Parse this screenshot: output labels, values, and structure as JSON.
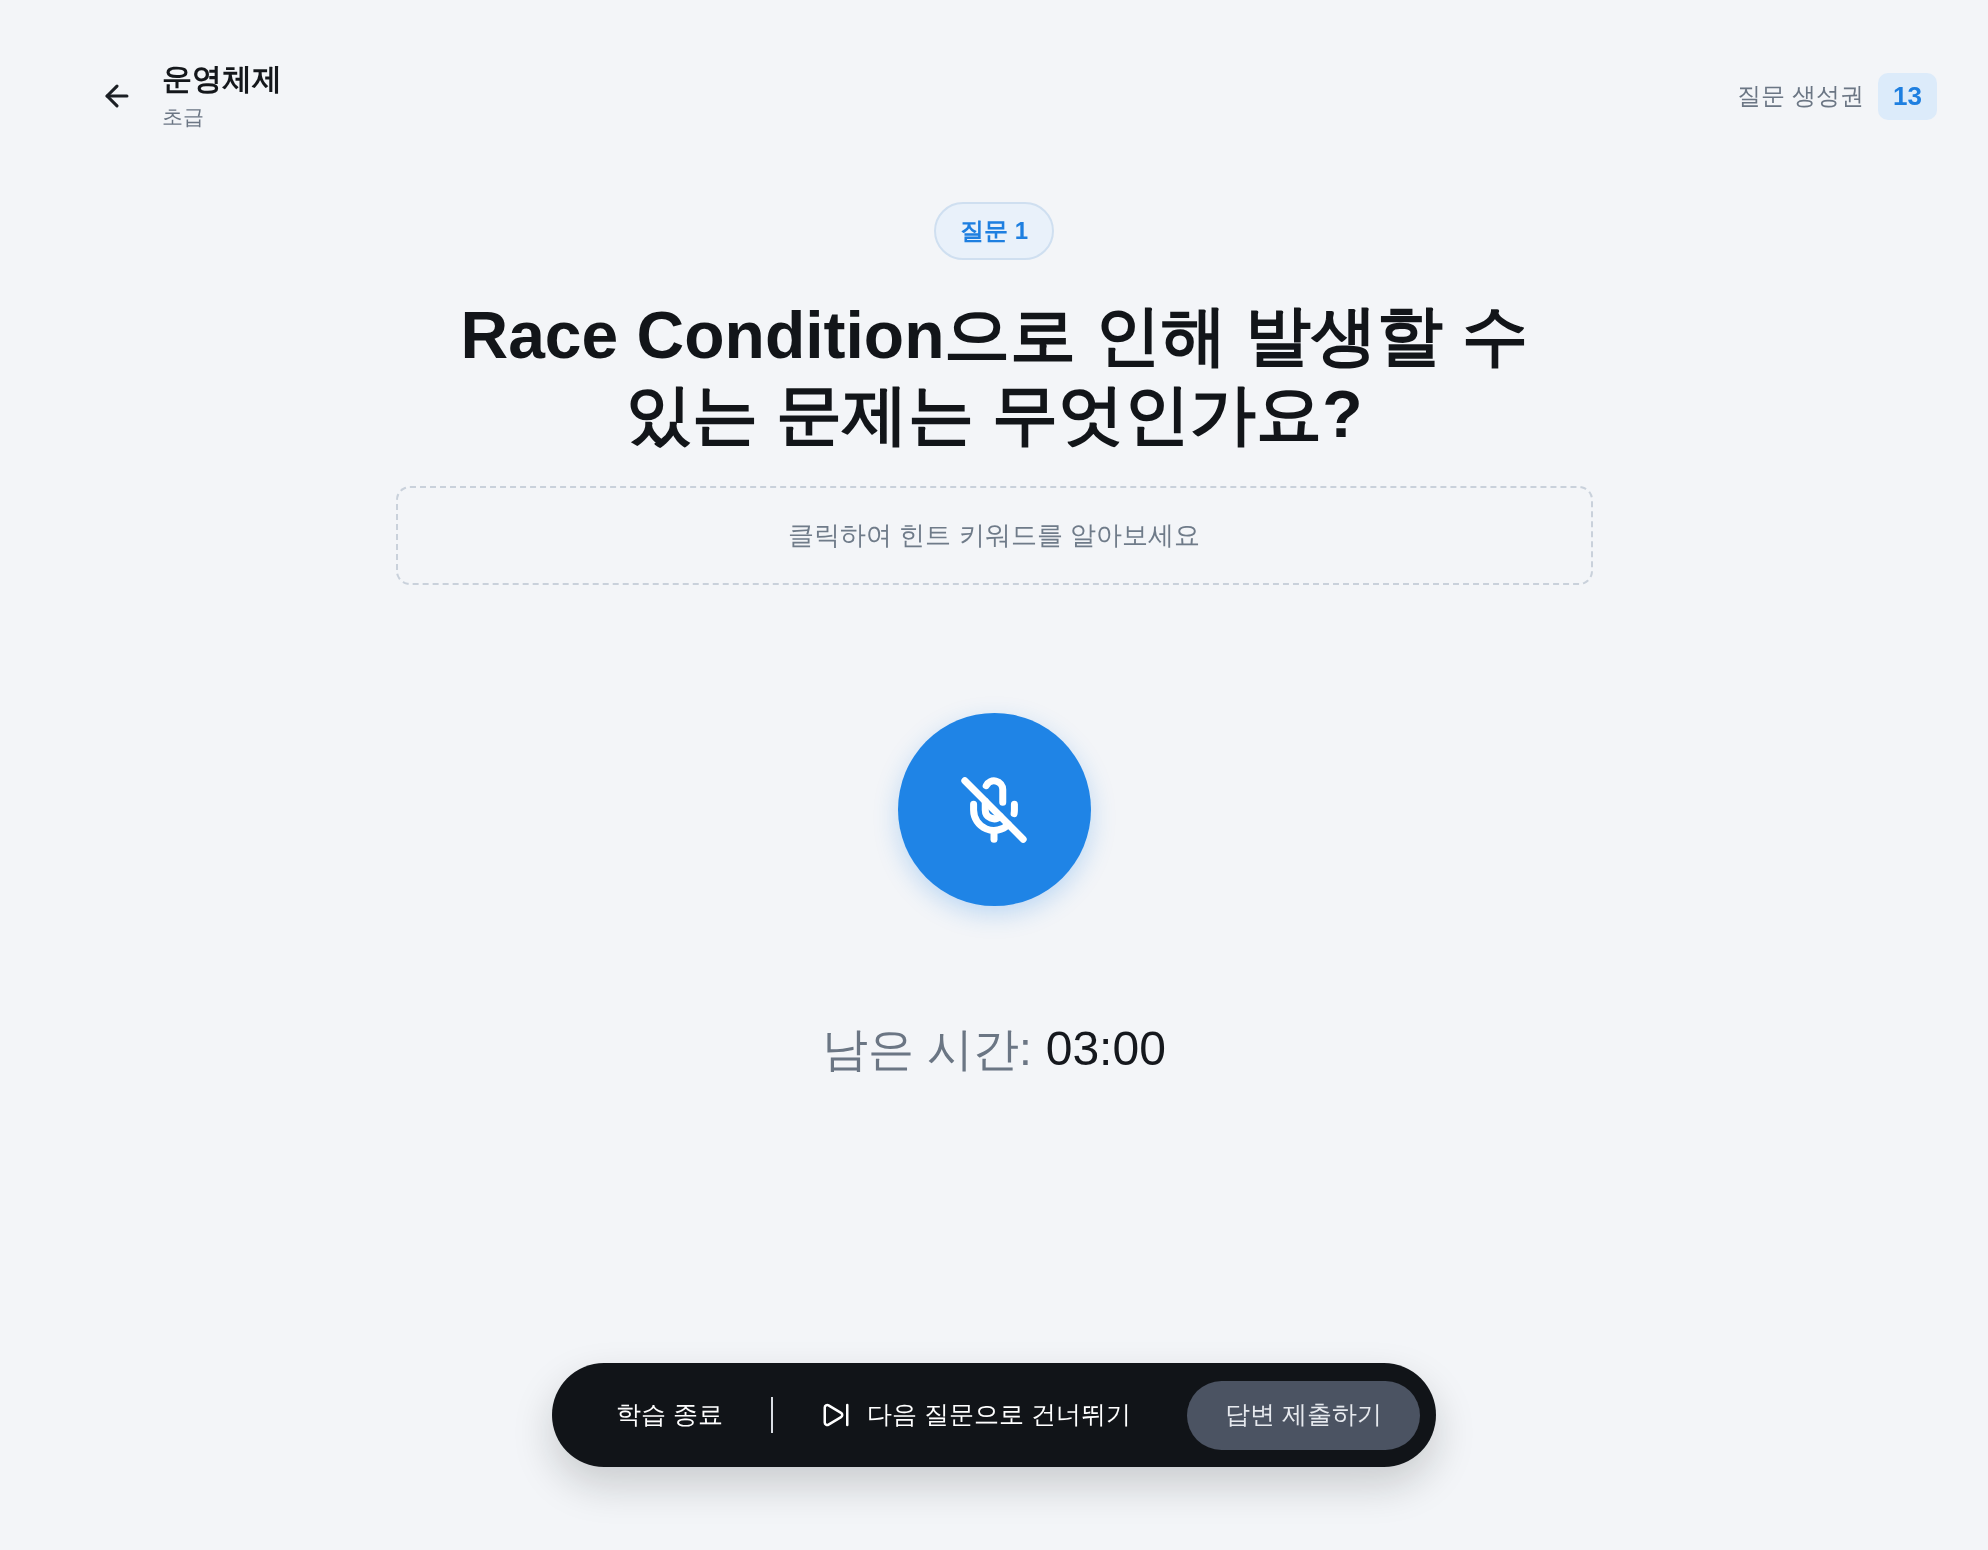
{
  "header": {
    "title": "운영체제",
    "subtitle": "초급",
    "quota": {
      "label": "질문 생성권",
      "count": "13"
    }
  },
  "question": {
    "badge": "질문 1",
    "text": "Race Condition으로 인해 발생할 수 있는 문제는 무엇인가요?",
    "hint": "클릭하여 힌트 키워드를 알아보세요"
  },
  "recorder": {
    "muted": true
  },
  "timer": {
    "label": "남은 시간:",
    "value": "03:00"
  },
  "actions": [
    {
      "kind": "plain",
      "label": "학습 종료"
    },
    {
      "kind": "skip",
      "label": "다음 질문으로 건너뛰기"
    },
    {
      "kind": "primary",
      "label": "답변 제출하기"
    }
  ]
}
